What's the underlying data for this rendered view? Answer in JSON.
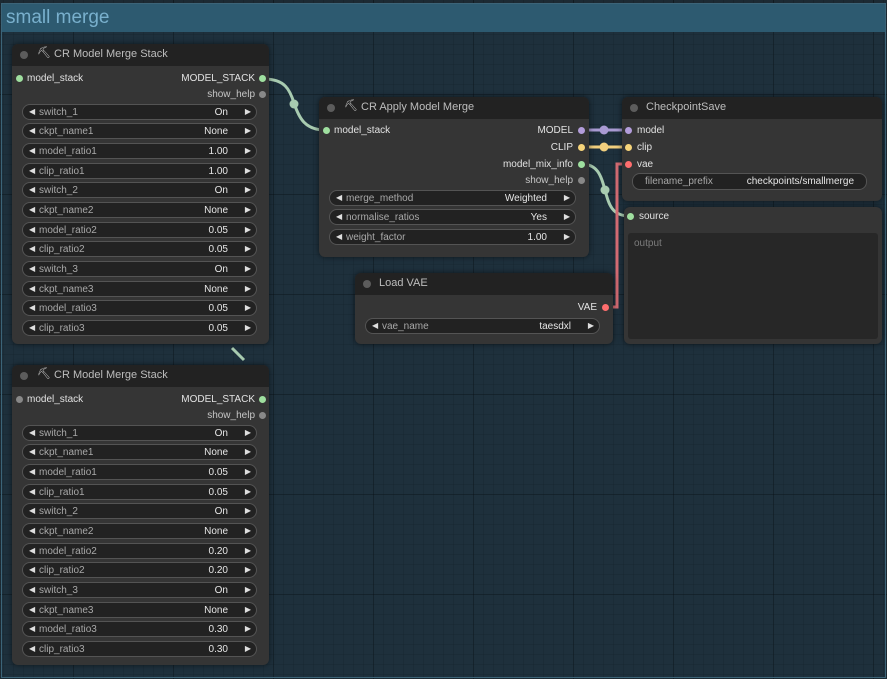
{
  "group": {
    "title": "small merge"
  },
  "colors": {
    "model_stack": "#a0d0a0",
    "model": "#b39ddb",
    "clip": "#f6d47a",
    "vae": "#ff6e6e",
    "string": "#9fdf9f",
    "help": "#888888"
  },
  "stack1": {
    "title": "CR Model Merge Stack",
    "input_model_stack": "model_stack",
    "output_model_stack": "MODEL_STACK",
    "output_show_help": "show_help",
    "widgets": [
      {
        "label": "switch_1",
        "value": "On"
      },
      {
        "label": "ckpt_name1",
        "value": "None"
      },
      {
        "label": "model_ratio1",
        "value": "1.00"
      },
      {
        "label": "clip_ratio1",
        "value": "1.00"
      },
      {
        "label": "switch_2",
        "value": "On"
      },
      {
        "label": "ckpt_name2",
        "value": "None"
      },
      {
        "label": "model_ratio2",
        "value": "0.05"
      },
      {
        "label": "clip_ratio2",
        "value": "0.05"
      },
      {
        "label": "switch_3",
        "value": "On"
      },
      {
        "label": "ckpt_name3",
        "value": "None"
      },
      {
        "label": "model_ratio3",
        "value": "0.05"
      },
      {
        "label": "clip_ratio3",
        "value": "0.05"
      }
    ]
  },
  "stack2": {
    "title": "CR Model Merge Stack",
    "input_model_stack": "model_stack",
    "output_model_stack": "MODEL_STACK",
    "output_show_help": "show_help",
    "widgets": [
      {
        "label": "switch_1",
        "value": "On"
      },
      {
        "label": "ckpt_name1",
        "value": "None"
      },
      {
        "label": "model_ratio1",
        "value": "0.05"
      },
      {
        "label": "clip_ratio1",
        "value": "0.05"
      },
      {
        "label": "switch_2",
        "value": "On"
      },
      {
        "label": "ckpt_name2",
        "value": "None"
      },
      {
        "label": "model_ratio2",
        "value": "0.20"
      },
      {
        "label": "clip_ratio2",
        "value": "0.20"
      },
      {
        "label": "switch_3",
        "value": "On"
      },
      {
        "label": "ckpt_name3",
        "value": "None"
      },
      {
        "label": "model_ratio3",
        "value": "0.30"
      },
      {
        "label": "clip_ratio3",
        "value": "0.30"
      }
    ]
  },
  "apply": {
    "title": "CR Apply Model Merge",
    "input_model_stack": "model_stack",
    "output_model": "MODEL",
    "output_clip": "CLIP",
    "output_mix_info": "model_mix_info",
    "output_show_help": "show_help",
    "widgets": [
      {
        "label": "merge_method",
        "value": "Weighted"
      },
      {
        "label": "normalise_ratios",
        "value": "Yes"
      },
      {
        "label": "weight_factor",
        "value": "1.00"
      }
    ]
  },
  "checkpoint_save": {
    "title": "CheckpointSave",
    "input_model": "model",
    "input_clip": "clip",
    "input_vae": "vae",
    "filename_prefix_label": "filename_prefix",
    "filename_prefix_value": "checkpoints/smallmerge"
  },
  "show_text": {
    "input_source": "source",
    "output_label": "output"
  },
  "load_vae": {
    "title": "Load VAE",
    "output_vae": "VAE",
    "widget_label": "vae_name",
    "widget_value": "taesdxl"
  },
  "icons": {
    "node_icon": "pickaxe-icon",
    "collapse_dot": "node-collapse-dot-icon",
    "arrow_left": "arrow-left-icon",
    "arrow_right": "arrow-right-icon"
  }
}
